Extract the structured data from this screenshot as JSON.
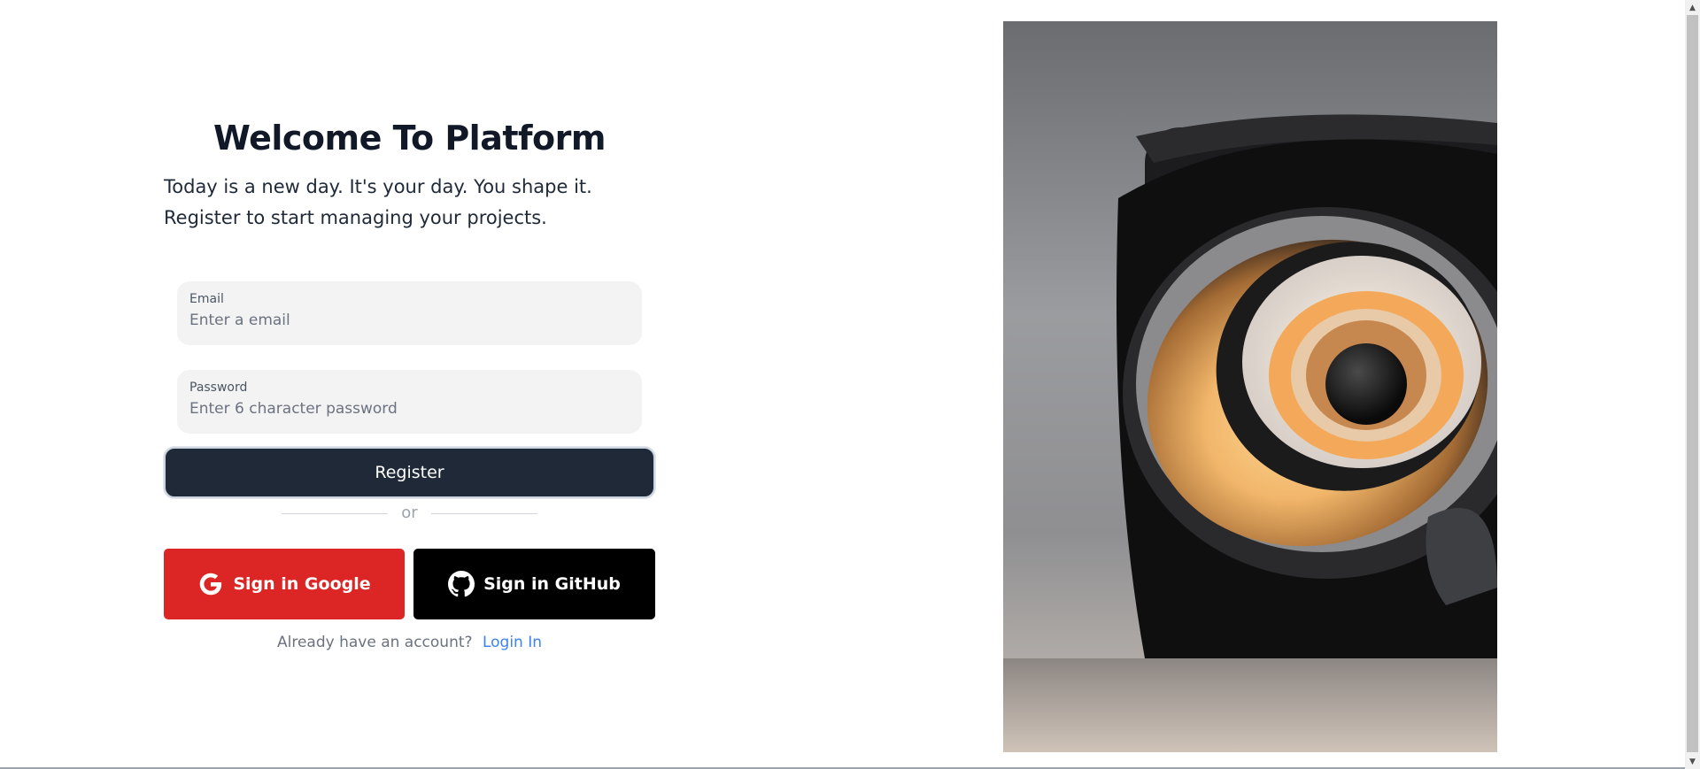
{
  "header": {
    "title": "Welcome To Platform",
    "subtitle": "Today is a new day. It's your day. You shape it. Register to start managing your projects."
  },
  "form": {
    "email": {
      "label": "Email",
      "placeholder": "Enter a email",
      "value": ""
    },
    "password": {
      "label": "Password",
      "placeholder": "Enter 6 character password",
      "value": ""
    },
    "register_label": "Register",
    "divider_text": "or"
  },
  "social": {
    "google": {
      "label": "Sign in Google",
      "icon": "google-icon",
      "color": "#dc2626"
    },
    "github": {
      "label": "Sign in GitHub",
      "icon": "github-icon",
      "color": "#000000"
    }
  },
  "footer": {
    "prompt": "Already have an account?",
    "login_label": "Login In"
  },
  "colors": {
    "primary_button": "#1f2937",
    "link": "#3b82f6",
    "input_bg": "#f3f3f3"
  },
  "art": {
    "description_icon": "abstract-art-image"
  }
}
